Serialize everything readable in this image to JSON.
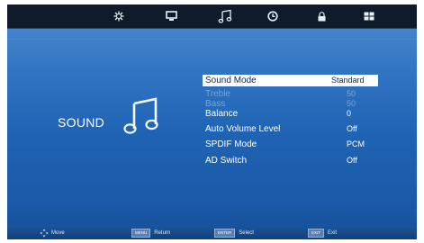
{
  "tabs": [
    {
      "icon": "picture-icon"
    },
    {
      "icon": "screen-icon"
    },
    {
      "icon": "music-note-icon",
      "active": true
    },
    {
      "icon": "clock-icon"
    },
    {
      "icon": "lock-icon"
    },
    {
      "icon": "grid-icon"
    }
  ],
  "section": {
    "title": "SOUND",
    "icon": "music-note-icon"
  },
  "menu": [
    {
      "label": "Sound Mode",
      "value": "Standard",
      "state": "selected"
    },
    {
      "label": "Treble",
      "value": "50",
      "state": "disabled"
    },
    {
      "label": "Bass",
      "value": "50",
      "state": "disabled"
    },
    {
      "label": "Balance",
      "value": "0",
      "state": "normal"
    },
    {
      "label": "Auto Volume Level",
      "value": "Off",
      "state": "normal"
    },
    {
      "label": "SPDIF Mode",
      "value": "PCM",
      "state": "normal"
    },
    {
      "label": "AD Switch",
      "value": "Off",
      "state": "normal"
    }
  ],
  "hints": [
    {
      "key": "",
      "label": "Move",
      "icon": "move-arrows-icon"
    },
    {
      "key": "MENU",
      "label": "Return"
    },
    {
      "key": "ENTER",
      "label": "Select"
    },
    {
      "key": "EXIT",
      "label": "Exit"
    }
  ],
  "colors": {
    "accent": "#1f63b4",
    "topbar": "#0f1b2b",
    "selected_bg": "#ffffff"
  }
}
